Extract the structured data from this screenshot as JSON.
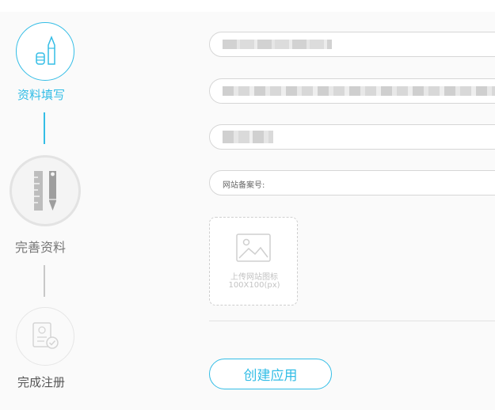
{
  "stepper": {
    "steps": [
      {
        "label": "资料填写",
        "icon": "pencil-document-icon",
        "state": "active"
      },
      {
        "label": "完善资料",
        "icon": "ruler-pen-icon",
        "state": "inactive"
      },
      {
        "label": "完成注册",
        "icon": "id-card-check-icon",
        "state": "inactive"
      }
    ]
  },
  "form": {
    "field_1_value": "(blurred)",
    "field_2_value": "(blurred)",
    "field_3_value": "(blurred)",
    "record_number_placeholder": "网站备案号:",
    "upload": {
      "icon": "image-icon",
      "label": "上传网站图标",
      "size_hint": "100X100(px)"
    },
    "create_button_label": "创建应用"
  },
  "colors": {
    "accent": "#33bde6",
    "inactive": "#cccccc",
    "border": "#d6d6d6",
    "background": "#fafafa"
  }
}
